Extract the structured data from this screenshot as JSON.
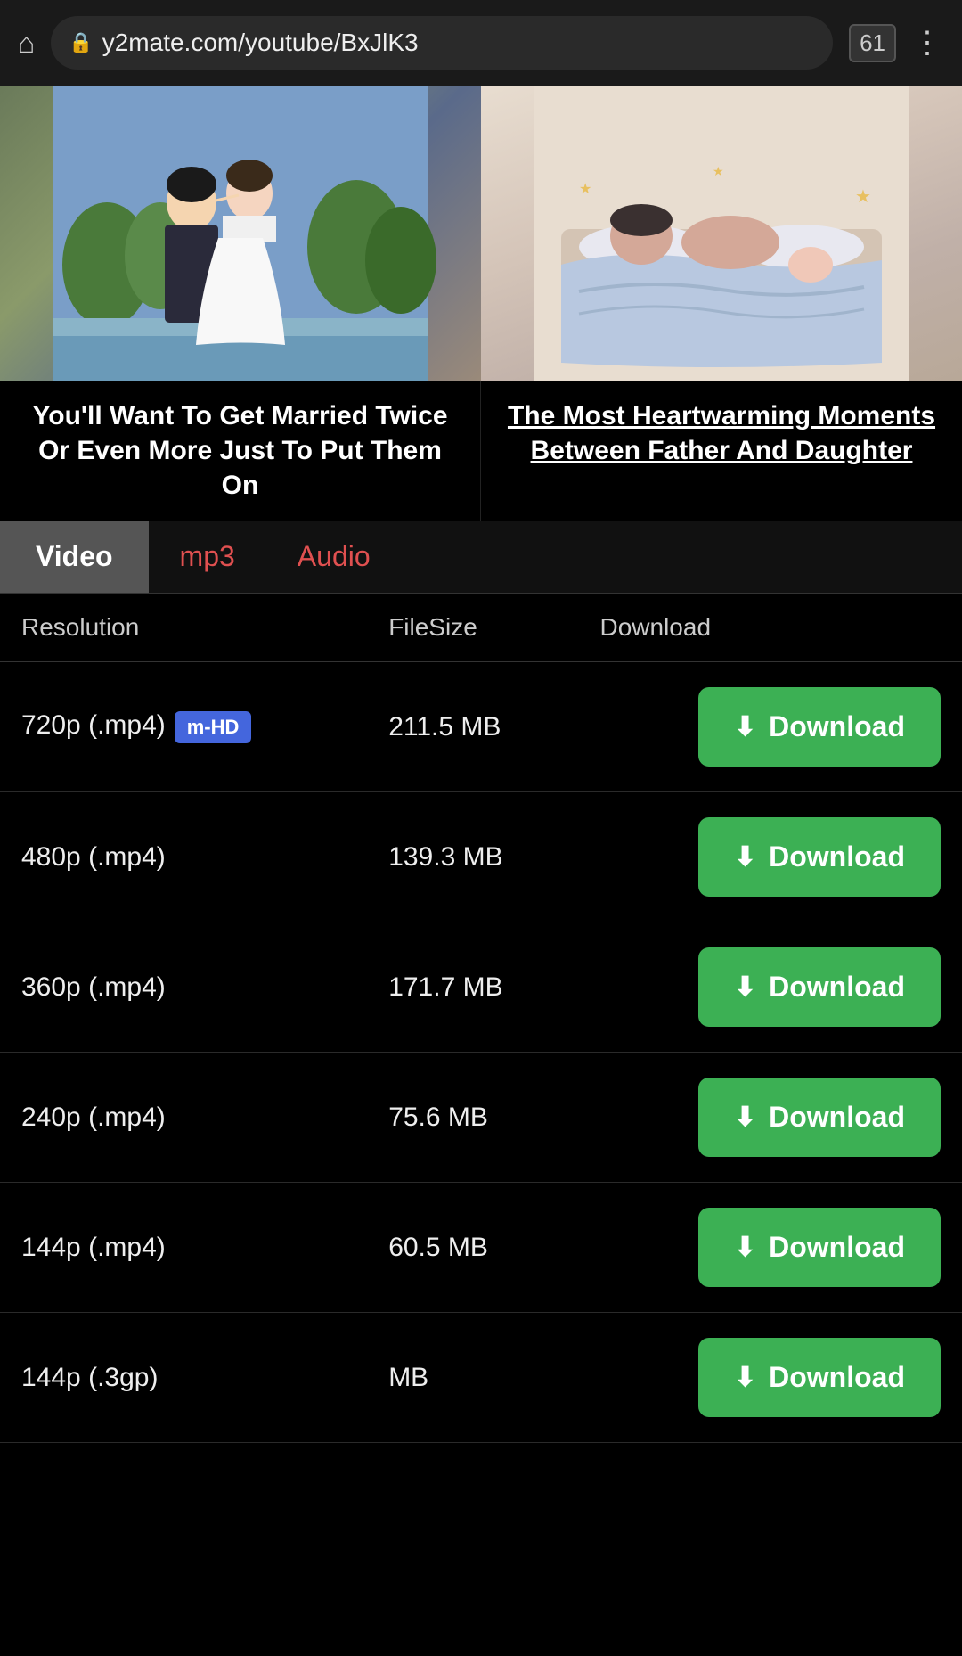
{
  "browser": {
    "url": "y2mate.com/youtube/BxJlK3",
    "tab_count": "61"
  },
  "left_video": {
    "title": "You'll Want To Get Married Twice Or Even More Just To Put Them On"
  },
  "right_video": {
    "title": "The Most Heartwarming Moments Between Father And Daughter"
  },
  "tabs": {
    "video": "Video",
    "mp3": "mp3",
    "audio": "Audio"
  },
  "table": {
    "headers": {
      "resolution": "Resolution",
      "filesize": "FileSize",
      "download": "Download"
    },
    "rows": [
      {
        "resolution": "720p (.mp4)",
        "badge": "m-HD",
        "filesize": "211.5 MB",
        "download": "Download"
      },
      {
        "resolution": "480p (.mp4)",
        "badge": "",
        "filesize": "139.3 MB",
        "download": "Download"
      },
      {
        "resolution": "360p (.mp4)",
        "badge": "",
        "filesize": "171.7 MB",
        "download": "Download"
      },
      {
        "resolution": "240p (.mp4)",
        "badge": "",
        "filesize": "75.6 MB",
        "download": "Download"
      },
      {
        "resolution": "144p (.mp4)",
        "badge": "",
        "filesize": "60.5 MB",
        "download": "Download"
      },
      {
        "resolution": "144p (.3gp)",
        "badge": "",
        "filesize": "MB",
        "download": "Download"
      }
    ]
  },
  "icons": {
    "home": "⌂",
    "lock": "🔒",
    "menu": "⋮",
    "download": "⬇"
  },
  "colors": {
    "download_btn": "#3cb054",
    "badge_mhd": "#4466dd",
    "tab_active_bg": "#555555",
    "tab_inactive_color": "#e05050"
  }
}
